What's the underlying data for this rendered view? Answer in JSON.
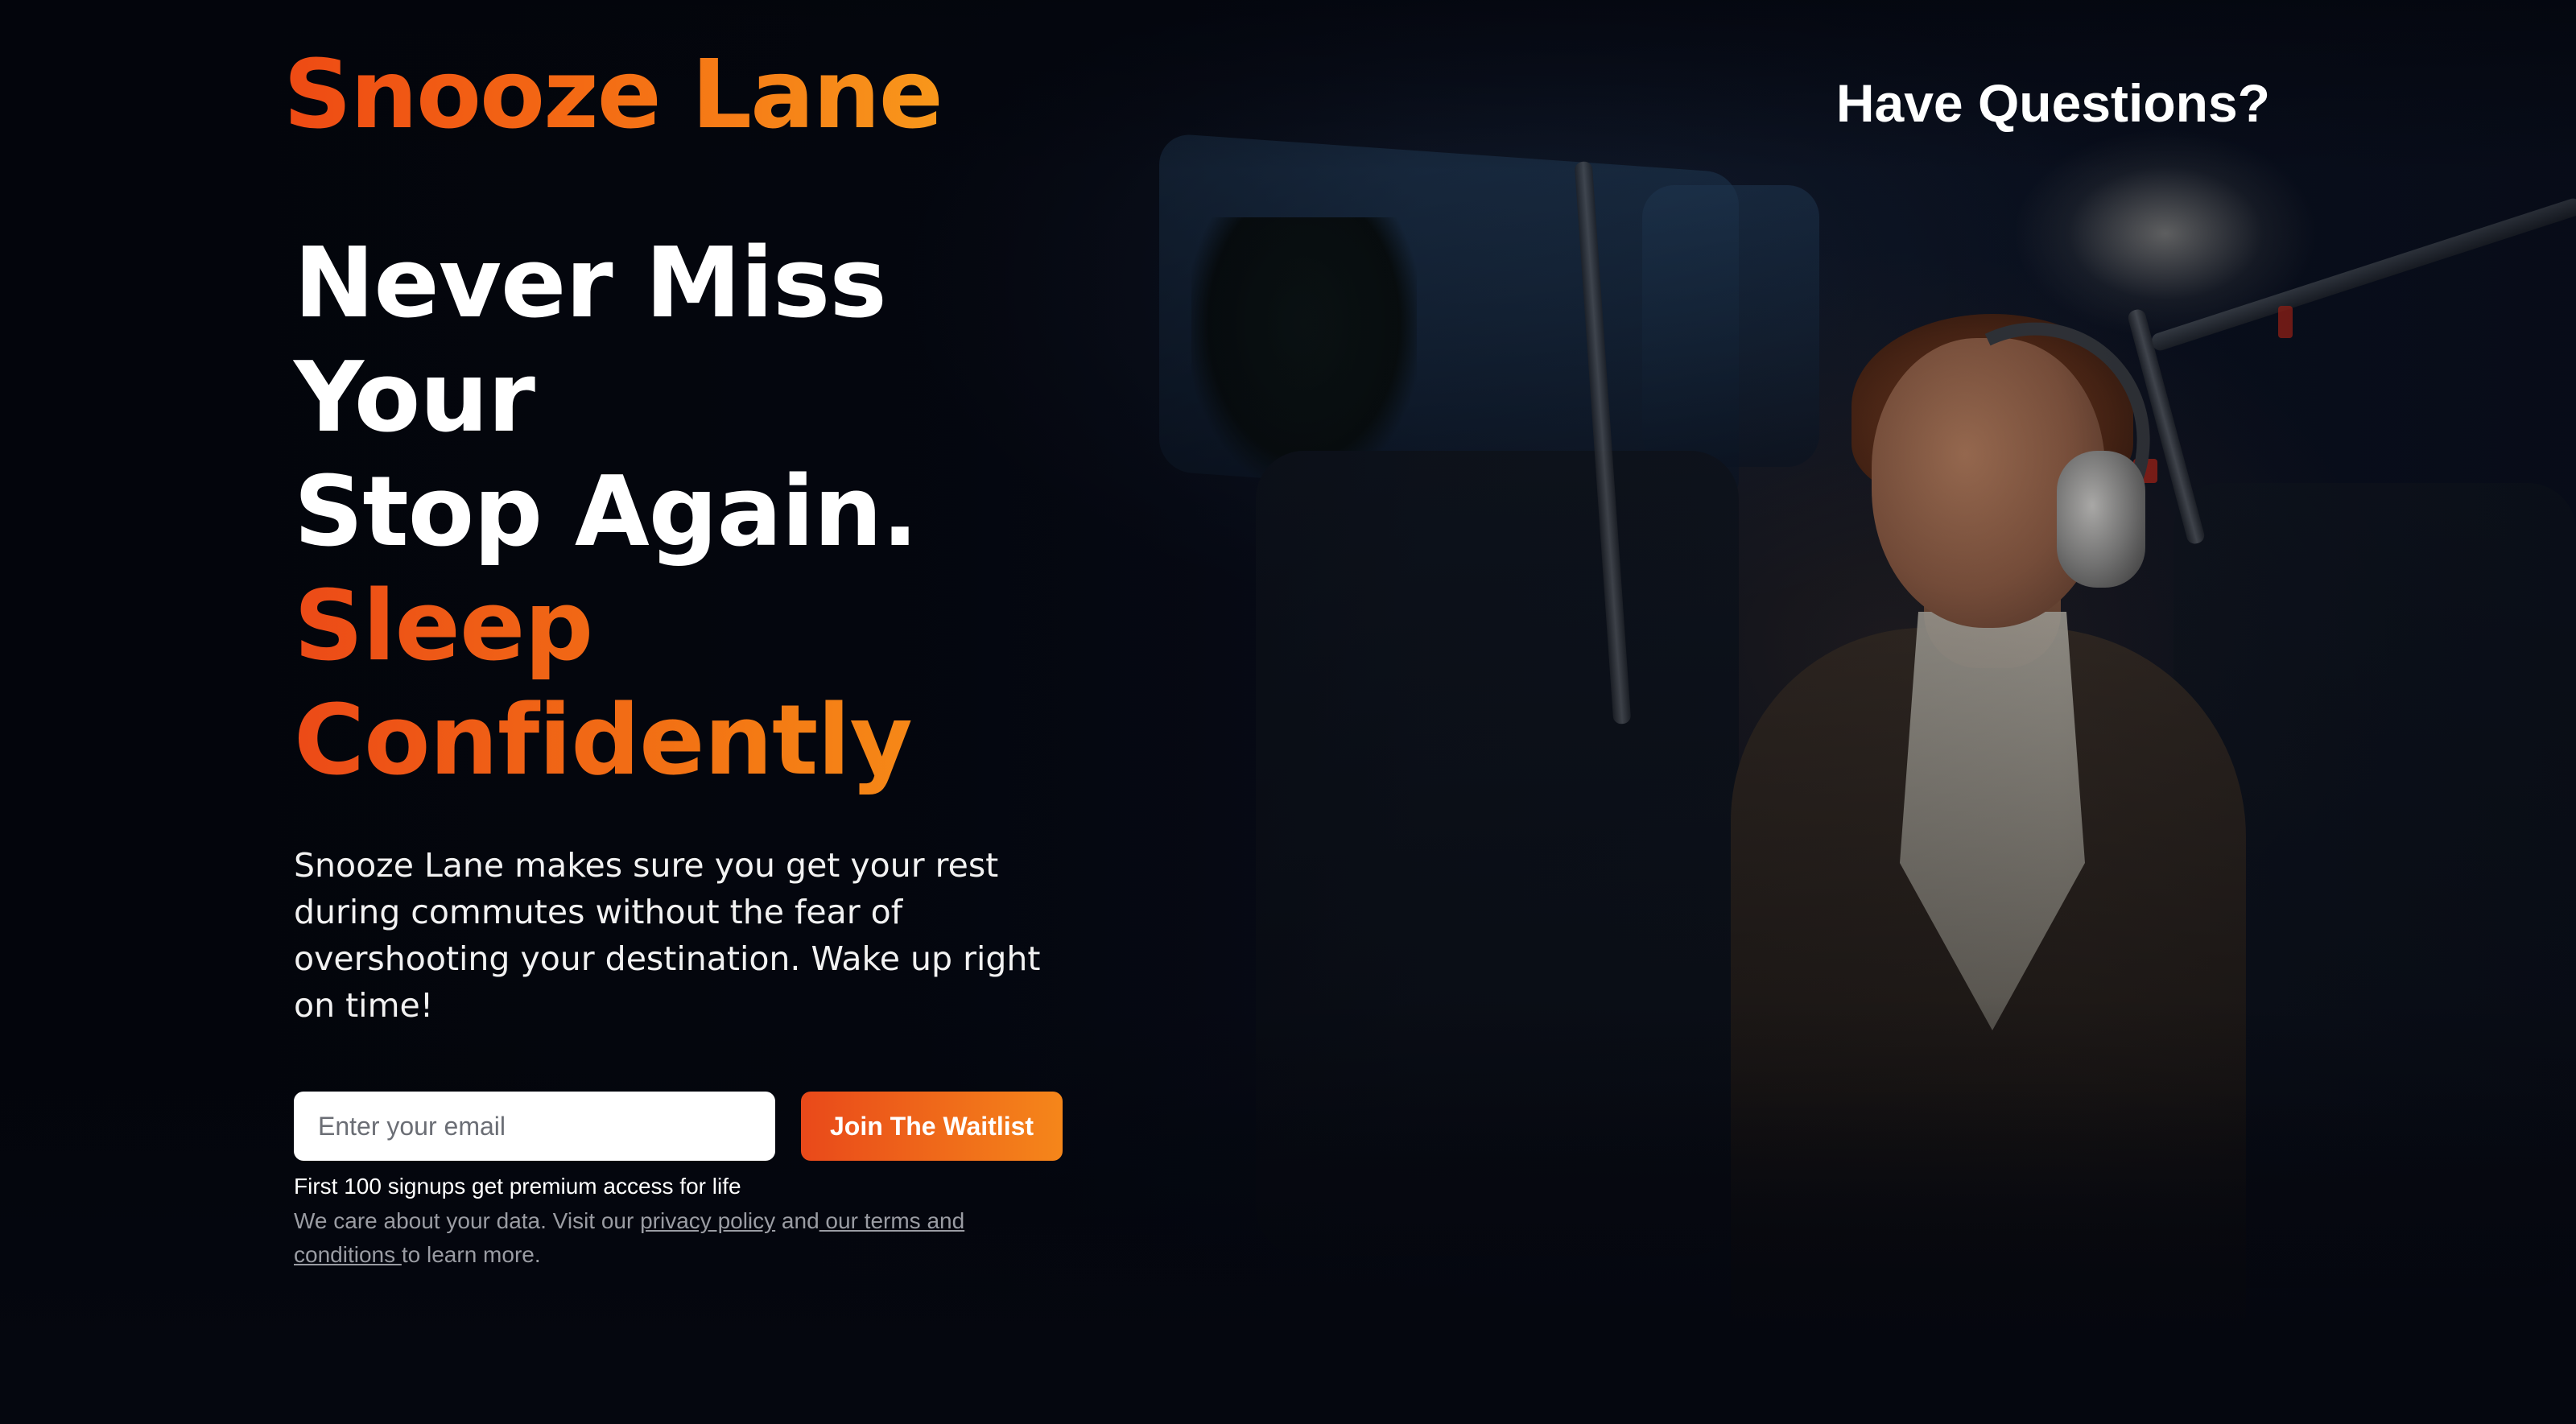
{
  "header": {
    "logo": "Snooze Lane",
    "questions_link": "Have Questions?"
  },
  "hero": {
    "headline_line1": "Never Miss Your",
    "headline_line2": "Stop Again.",
    "headline_accent": "Sleep Confidently",
    "description": "Snooze Lane makes sure you get your rest during commutes without the fear of overshooting your destination. Wake up right on time!"
  },
  "signup": {
    "email_placeholder": "Enter your email",
    "button_label": "Join The Waitlist",
    "promo_text": "First 100 signups get premium access for life",
    "legal_prefix": "We care about your data. Visit our ",
    "privacy_link": "privacy policy",
    "legal_and": " and",
    "terms_link": " our terms and conditions ",
    "legal_suffix": "to learn more."
  },
  "background": {
    "image": "woman-sleeping-on-train-with-headphones"
  },
  "colors": {
    "accent_start": "#ec4a17",
    "accent_end": "#f89c1c",
    "background": "#05070f"
  }
}
